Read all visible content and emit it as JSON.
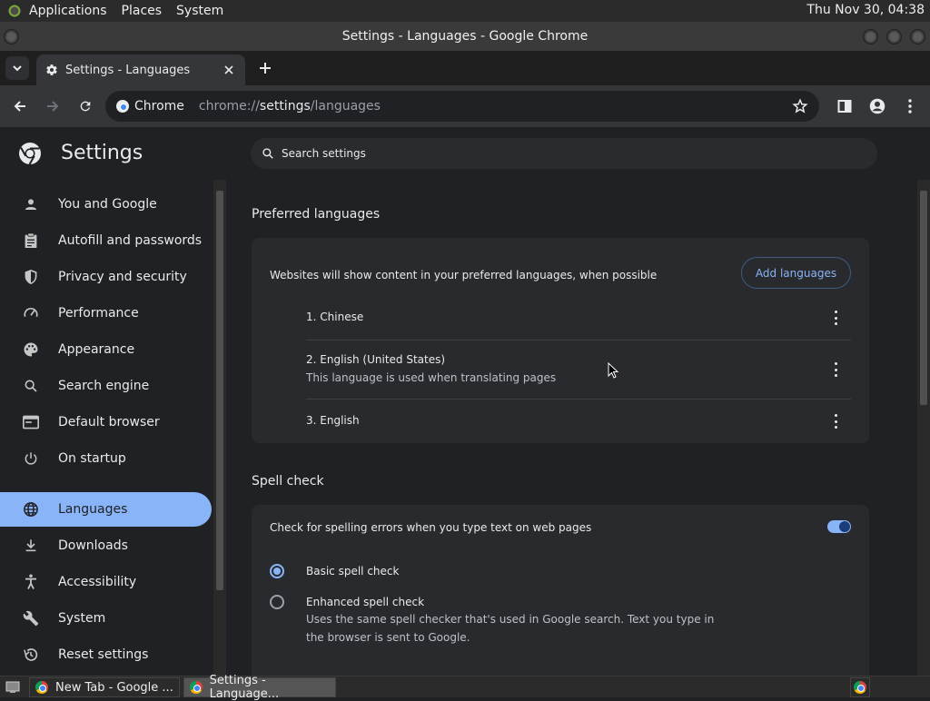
{
  "gnome_panel": {
    "menus": [
      "Applications",
      "Places",
      "System"
    ],
    "clock": "Thu Nov 30, 04:38"
  },
  "window": {
    "title": "Settings - Languages - Google Chrome"
  },
  "tab": {
    "title": "Settings - Languages"
  },
  "toolbar": {
    "chip_label": "Chrome",
    "url_scheme": "chrome://",
    "url_host": "settings",
    "url_path": "/languages"
  },
  "settings": {
    "title": "Settings",
    "search_placeholder": "Search settings",
    "nav": [
      {
        "label": "You and Google",
        "icon": "person-icon"
      },
      {
        "label": "Autofill and passwords",
        "icon": "clipboard-icon"
      },
      {
        "label": "Privacy and security",
        "icon": "shield-icon"
      },
      {
        "label": "Performance",
        "icon": "speedometer-icon"
      },
      {
        "label": "Appearance",
        "icon": "palette-icon"
      },
      {
        "label": "Search engine",
        "icon": "search-icon"
      },
      {
        "label": "Default browser",
        "icon": "browser-icon"
      },
      {
        "label": "On startup",
        "icon": "power-icon"
      },
      {
        "label": "Languages",
        "icon": "globe-icon",
        "active": true
      },
      {
        "label": "Downloads",
        "icon": "download-icon"
      },
      {
        "label": "Accessibility",
        "icon": "accessibility-icon"
      },
      {
        "label": "System",
        "icon": "wrench-icon"
      },
      {
        "label": "Reset settings",
        "icon": "history-icon"
      }
    ],
    "preferred_languages": {
      "title": "Preferred languages",
      "description": "Websites will show content in your preferred languages, when possible",
      "add_button": "Add languages",
      "languages": [
        {
          "name": "1. Chinese"
        },
        {
          "name": "2. English (United States)",
          "note": "This language is used when translating pages"
        },
        {
          "name": "3. English"
        }
      ]
    },
    "spell_check": {
      "title": "Spell check",
      "toggle_label": "Check for spelling errors when you type text on web pages",
      "toggle_on": true,
      "basic_label": "Basic spell check",
      "enhanced_label": "Enhanced spell check",
      "enhanced_note": "Uses the same spell checker that's used in Google search. Text you type in the browser is sent to Google.",
      "selected": "basic"
    }
  },
  "taskbar": {
    "tasks": [
      "New Tab - Google ...",
      "Settings - Language..."
    ]
  },
  "colors": {
    "accent": "#8ab4f8",
    "background": "#202124",
    "card": "#292a2d"
  }
}
